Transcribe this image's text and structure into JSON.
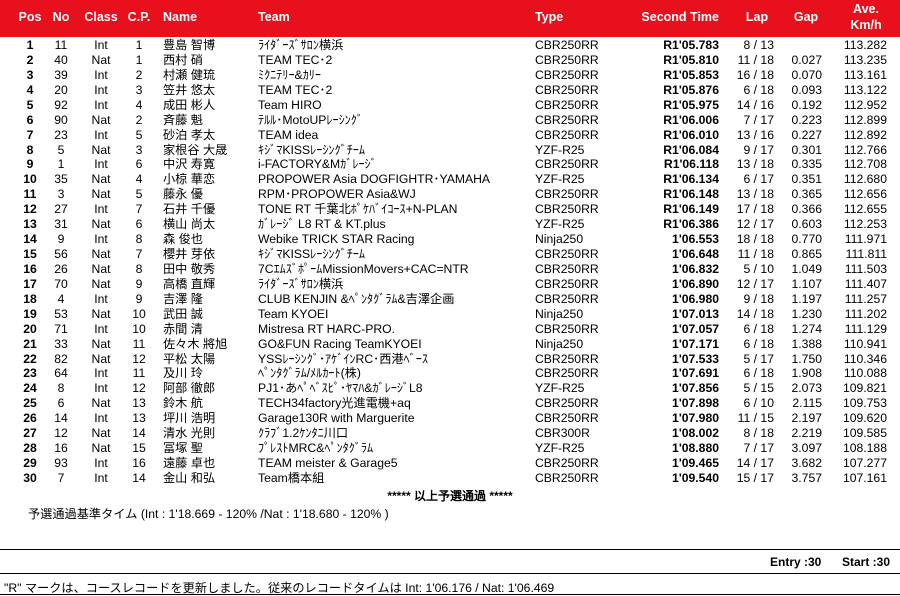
{
  "headers": {
    "pos": "Pos",
    "no": "No",
    "class": "Class",
    "cp": "C.P.",
    "name": "Name",
    "team": "Team",
    "type": "Type",
    "second_time": "Second Time",
    "lap": "Lap",
    "gap": "Gap",
    "ave_line1": "Ave.",
    "ave_line2": "Km/h"
  },
  "rows": [
    {
      "pos": "1",
      "no": "11",
      "class": "Int",
      "cp": "1",
      "name": "豊島 智博",
      "team": "ﾗｲﾀﾞｰｽﾞｻﾛﾝ横浜",
      "type": "CBR250RR",
      "time": "R1'05.783",
      "lap": "8 / 13",
      "gap": "",
      "ave": "113.282"
    },
    {
      "pos": "2",
      "no": "40",
      "class": "Nat",
      "cp": "1",
      "name": "西村 硝",
      "team": "TEAM TEC･2",
      "type": "CBR250RR",
      "time": "R1'05.810",
      "lap": "11 / 18",
      "gap": "0.027",
      "ave": "113.235"
    },
    {
      "pos": "3",
      "no": "39",
      "class": "Int",
      "cp": "2",
      "name": "村瀬 健琉",
      "team": "ﾐｸﾆﾃﾘｰ&ｶﾘｰ",
      "type": "CBR250RR",
      "time": "R1'05.853",
      "lap": "16 / 18",
      "gap": "0.070",
      "ave": "113.161"
    },
    {
      "pos": "4",
      "no": "20",
      "class": "Int",
      "cp": "3",
      "name": "笠井 悠太",
      "team": "TEAM TEC･2",
      "type": "CBR250RR",
      "time": "R1'05.876",
      "lap": "6 / 18",
      "gap": "0.093",
      "ave": "113.122"
    },
    {
      "pos": "5",
      "no": "92",
      "class": "Int",
      "cp": "4",
      "name": "成田 彬人",
      "team": "Team HIRO",
      "type": "CBR250RR",
      "time": "R1'05.975",
      "lap": "14 / 16",
      "gap": "0.192",
      "ave": "112.952"
    },
    {
      "pos": "6",
      "no": "90",
      "class": "Nat",
      "cp": "2",
      "name": "斉藤 魁",
      "team": "ﾃﾙﾙ･MotoUPﾚｰｼﾝｸﾞ",
      "type": "CBR250RR",
      "time": "R1'06.006",
      "lap": "7 / 17",
      "gap": "0.223",
      "ave": "112.899"
    },
    {
      "pos": "7",
      "no": "23",
      "class": "Int",
      "cp": "5",
      "name": "砂泊 孝太",
      "team": "TEAM idea",
      "type": "CBR250RR",
      "time": "R1'06.010",
      "lap": "13 / 16",
      "gap": "0.227",
      "ave": "112.892"
    },
    {
      "pos": "8",
      "no": "5",
      "class": "Nat",
      "cp": "3",
      "name": "家根谷 大晟",
      "team": "ｷｼﾞﾏKISSﾚｰｼﾝｸﾞﾁｰﾑ",
      "type": "YZF-R25",
      "time": "R1'06.084",
      "lap": "9 / 17",
      "gap": "0.301",
      "ave": "112.766"
    },
    {
      "pos": "9",
      "no": "1",
      "class": "Int",
      "cp": "6",
      "name": "中沢 寿寛",
      "team": "i-FACTORY&Mｶﾞﾚｰｼﾞ",
      "type": "CBR250RR",
      "time": "R1'06.118",
      "lap": "13 / 18",
      "gap": "0.335",
      "ave": "112.708"
    },
    {
      "pos": "10",
      "no": "35",
      "class": "Nat",
      "cp": "4",
      "name": "小椋 華恋",
      "team": "PROPOWER Asia DOGFIGHTR･YAMAHA",
      "type": "YZF-R25",
      "time": "R1'06.134",
      "lap": "6 / 17",
      "gap": "0.351",
      "ave": "112.680"
    },
    {
      "pos": "11",
      "no": "3",
      "class": "Nat",
      "cp": "5",
      "name": "藤永 優",
      "team": "RPM･PROPOWER Asia&WJ",
      "type": "CBR250RR",
      "time": "R1'06.148",
      "lap": "13 / 18",
      "gap": "0.365",
      "ave": "112.656"
    },
    {
      "pos": "12",
      "no": "27",
      "class": "Int",
      "cp": "7",
      "name": "石井 千優",
      "team": "TONE RT 千葉北ﾎﾟｹﾊﾞｲｺｰｽ+N-PLAN",
      "type": "CBR250RR",
      "time": "R1'06.149",
      "lap": "17 / 18",
      "gap": "0.366",
      "ave": "112.655"
    },
    {
      "pos": "13",
      "no": "31",
      "class": "Nat",
      "cp": "6",
      "name": "横山 尚太",
      "team": "ｶﾞﾚｰｼﾞ L8 RT & KT.plus",
      "type": "YZF-R25",
      "time": "R1'06.386",
      "lap": "12 / 17",
      "gap": "0.603",
      "ave": "112.253"
    },
    {
      "pos": "14",
      "no": "9",
      "class": "Int",
      "cp": "8",
      "name": "森 俊也",
      "team": "Webike TRICK STAR Racing",
      "type": "Ninja250",
      "time": "1'06.553",
      "lap": "18 / 18",
      "gap": "0.770",
      "ave": "111.971"
    },
    {
      "pos": "15",
      "no": "56",
      "class": "Nat",
      "cp": "7",
      "name": "櫻井 芽依",
      "team": "ｷｼﾞﾏKISSﾚｰｼﾝｸﾞﾁｰﾑ",
      "type": "CBR250RR",
      "time": "1'06.648",
      "lap": "11 / 18",
      "gap": "0.865",
      "ave": "111.811"
    },
    {
      "pos": "16",
      "no": "26",
      "class": "Nat",
      "cp": "8",
      "name": "田中 敬秀",
      "team": "7CｴﾑｽﾞﾎﾟｰﾑMissionMovers+CAC=NTR",
      "type": "CBR250RR",
      "time": "1'06.832",
      "lap": "5 / 10",
      "gap": "1.049",
      "ave": "111.503"
    },
    {
      "pos": "17",
      "no": "70",
      "class": "Nat",
      "cp": "9",
      "name": "高橋 直輝",
      "team": "ﾗｲﾀﾞｰｽﾞｻﾛﾝ横浜",
      "type": "CBR250RR",
      "time": "1'06.890",
      "lap": "12 / 17",
      "gap": "1.107",
      "ave": "111.407"
    },
    {
      "pos": "18",
      "no": "4",
      "class": "Int",
      "cp": "9",
      "name": "吉澤 隆",
      "team": "CLUB KENJIN &ﾍﾟﾝﾀｸﾞﾗﾑ&吉澤企画",
      "type": "CBR250RR",
      "time": "1'06.980",
      "lap": "9 / 18",
      "gap": "1.197",
      "ave": "111.257"
    },
    {
      "pos": "19",
      "no": "53",
      "class": "Nat",
      "cp": "10",
      "name": "武田 誠",
      "team": "Team KYOEI",
      "type": "Ninja250",
      "time": "1'07.013",
      "lap": "14 / 18",
      "gap": "1.230",
      "ave": "111.202"
    },
    {
      "pos": "20",
      "no": "71",
      "class": "Int",
      "cp": "10",
      "name": "赤間 清",
      "team": "Mistresa RT HARC-PRO.",
      "type": "CBR250RR",
      "time": "1'07.057",
      "lap": "6 / 18",
      "gap": "1.274",
      "ave": "111.129"
    },
    {
      "pos": "21",
      "no": "33",
      "class": "Nat",
      "cp": "11",
      "name": "佐々木 將旭",
      "team": "GO&FUN Racing TeamKYOEI",
      "type": "Ninja250",
      "time": "1'07.171",
      "lap": "6 / 18",
      "gap": "1.388",
      "ave": "110.941"
    },
    {
      "pos": "22",
      "no": "82",
      "class": "Nat",
      "cp": "12",
      "name": "平松 太陽",
      "team": "YSSﾚｰｼﾝｸﾞ･ｱｹﾞｲﾝRC･西港ﾍﾞｰｽ",
      "type": "CBR250RR",
      "time": "1'07.533",
      "lap": "5 / 17",
      "gap": "1.750",
      "ave": "110.346"
    },
    {
      "pos": "23",
      "no": "64",
      "class": "Int",
      "cp": "11",
      "name": "及川 玲",
      "team": "ﾍﾟﾝﾀｸﾞﾗﾑ/ﾒﾙｶｰﾄ(株)",
      "type": "CBR250RR",
      "time": "1'07.691",
      "lap": "6 / 18",
      "gap": "1.908",
      "ave": "110.088"
    },
    {
      "pos": "24",
      "no": "8",
      "class": "Int",
      "cp": "12",
      "name": "阿部 徹郎",
      "team": "PJ1･あﾍﾟﾍﾞｽﾋﾟ･ﾔﾏﾊ&ｶﾞﾚｰｼﾞL8",
      "type": "YZF-R25",
      "time": "1'07.856",
      "lap": "5 / 15",
      "gap": "2.073",
      "ave": "109.821"
    },
    {
      "pos": "25",
      "no": "6",
      "class": "Nat",
      "cp": "13",
      "name": "鈴木 航",
      "team": "TECH34factory光進電機+aq",
      "type": "CBR250RR",
      "time": "1'07.898",
      "lap": "6 / 10",
      "gap": "2.115",
      "ave": "109.753"
    },
    {
      "pos": "26",
      "no": "14",
      "class": "Int",
      "cp": "13",
      "name": "坪川 浩明",
      "team": "Garage130R with Marguerite",
      "type": "CBR250RR",
      "time": "1'07.980",
      "lap": "11 / 15",
      "gap": "2.197",
      "ave": "109.620"
    },
    {
      "pos": "27",
      "no": "12",
      "class": "Nat",
      "cp": "14",
      "name": "清水 光則",
      "team": "ｸﾗﾌﾞ1.2ｹﾝﾀﾆ川口",
      "type": "CBR300R",
      "time": "1'08.002",
      "lap": "8 / 18",
      "gap": "2.219",
      "ave": "109.585"
    },
    {
      "pos": "28",
      "no": "16",
      "class": "Nat",
      "cp": "15",
      "name": "冨塚 聖",
      "team": "ﾌﾟﾚｽﾄMRC&ﾍﾟﾝﾀｸﾞﾗﾑ",
      "type": "YZF-R25",
      "time": "1'08.880",
      "lap": "7 / 17",
      "gap": "3.097",
      "ave": "108.188"
    },
    {
      "pos": "29",
      "no": "93",
      "class": "Int",
      "cp": "16",
      "name": "遠藤 卓也",
      "team": "TEAM meister & Garage5",
      "type": "CBR250RR",
      "time": "1'09.465",
      "lap": "14 / 17",
      "gap": "3.682",
      "ave": "107.277"
    },
    {
      "pos": "30",
      "no": "7",
      "class": "Int",
      "cp": "14",
      "name": "金山 和弘",
      "team": "Team橋本組",
      "type": "CBR250RR",
      "time": "1'09.540",
      "lap": "15 / 17",
      "gap": "3.757",
      "ave": "107.161"
    }
  ],
  "qualified_note": "***** 以上予選通過 *****",
  "base_time_note": "予選通過基準タイム (Int : 1'18.669 - 120% /Nat : 1'18.680 - 120% )",
  "entry": "Entry :30",
  "start": "Start :30",
  "record_note": "\"R\" マークは、コースレコードを更新しました。従来のレコードタイムは Int: 1'06.176 / Nat: 1'06.469",
  "colors": {
    "header_bg": "#e8101c",
    "header_text": "#ffffff"
  }
}
